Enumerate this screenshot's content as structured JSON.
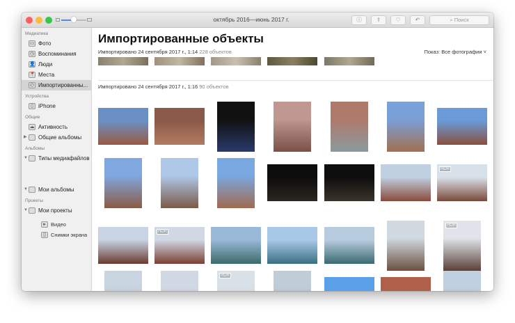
{
  "window": {
    "title": "октябрь 2016—июнь 2017 г."
  },
  "toolbar": {
    "info": "ⓘ",
    "share": "⇪",
    "favorite": "♡",
    "rotate": "↶",
    "search_placeholder": "Поиск"
  },
  "sidebar": {
    "sections": [
      {
        "label": "Медиатека",
        "items": [
          {
            "label": "Фото",
            "icon": "photos-icon"
          },
          {
            "label": "Воспоминания",
            "icon": "memories-icon"
          },
          {
            "label": "Люди",
            "icon": "people-icon"
          },
          {
            "label": "Места",
            "icon": "places-icon"
          },
          {
            "label": "Импортированны...",
            "icon": "clock-icon",
            "selected": true
          }
        ]
      },
      {
        "label": "Устройства",
        "items": [
          {
            "label": "iPhone",
            "icon": "iphone-icon"
          }
        ]
      },
      {
        "label": "Общие",
        "items": [
          {
            "label": "Активность",
            "icon": "cloud-icon"
          },
          {
            "label": "Общие альбомы",
            "icon": "album-icon",
            "disclosure": "▶"
          }
        ]
      },
      {
        "label": "Альбомы",
        "items": [
          {
            "label": "Типы медиафайлов",
            "icon": "album-icon",
            "disclosure": "▼"
          },
          {
            "label": "Видео",
            "icon": "video-icon",
            "indent": true
          },
          {
            "label": "Снимки экрана",
            "icon": "screenshot-icon",
            "indent": true
          },
          {
            "label": "Мои альбомы",
            "icon": "album-icon",
            "disclosure": "▼"
          }
        ]
      },
      {
        "label": "Проекты",
        "items": [
          {
            "label": "Мои проекты",
            "icon": "album-icon",
            "disclosure": "▼"
          }
        ]
      }
    ]
  },
  "main": {
    "title": "Импортированные объекты",
    "import1": {
      "label": "Импортировано 24 сентября 2017 г., 1:14",
      "count": "228 объектов"
    },
    "show": "Показ: Все фотографии ˅",
    "import2": {
      "label": "Импортировано 24 сентября 2017 г., 1:16",
      "count": "90 объектов"
    },
    "hdr_label": "HDR",
    "photos": [
      {
        "o": "landscape",
        "c1": "#6a8fc4",
        "c2": "#9a5a44"
      },
      {
        "o": "landscape",
        "c1": "#8a5a48",
        "c2": "#b27b62"
      },
      {
        "o": "portrait",
        "c1": "#111",
        "c2": "#2a3a6a"
      },
      {
        "o": "portrait",
        "c1": "#c09890",
        "c2": "#7a5048"
      },
      {
        "o": "portrait",
        "c1": "#b07a6a",
        "c2": "#8a9aa0"
      },
      {
        "o": "portrait",
        "c1": "#7aa0d8",
        "c2": "#a07050"
      },
      {
        "o": "landscape",
        "c1": "#6a9ad8",
        "c2": "#8a5040"
      },
      {
        "o": "portrait",
        "c1": "#80a8e0",
        "c2": "#8a5a44"
      },
      {
        "o": "portrait",
        "c1": "#b0c8e8",
        "c2": "#7a5a48"
      },
      {
        "o": "portrait",
        "c1": "#7aa8e0",
        "c2": "#a06a50"
      },
      {
        "o": "landscape",
        "c1": "#0c0c0c",
        "c2": "#2a2620"
      },
      {
        "o": "landscape",
        "c1": "#0e0e0e",
        "c2": "#3a342a"
      },
      {
        "o": "landscape",
        "c1": "#c0d0e0",
        "c2": "#8a4a3a"
      },
      {
        "o": "landscape",
        "c1": "#d8e0ea",
        "c2": "#7a4a3a",
        "hdr": true
      },
      {
        "o": "landscape",
        "c1": "#c8d4e4",
        "c2": "#6a3a30"
      },
      {
        "o": "landscape",
        "c1": "#d0d8e4",
        "c2": "#7a4034",
        "hdr": true
      },
      {
        "o": "landscape",
        "c1": "#9ab8d8",
        "c2": "#3a6a6a"
      },
      {
        "o": "landscape",
        "c1": "#a8c8e8",
        "c2": "#3a7080"
      },
      {
        "o": "landscape",
        "c1": "#b8cce0",
        "c2": "#3a6a70"
      },
      {
        "o": "portrait",
        "c1": "#d0d8e0",
        "c2": "#6a5040"
      },
      {
        "o": "portrait",
        "c1": "#e0e4ea",
        "c2": "#5a4038",
        "hdr": true
      },
      {
        "o": "portrait",
        "c1": "#c8d4e0",
        "c2": "#6a5a50"
      },
      {
        "o": "portrait",
        "c1": "#d0d8e4",
        "c2": "#7a6a60"
      },
      {
        "o": "portrait",
        "c1": "#d8e0e8",
        "c2": "#8a7a70",
        "hdr": true
      },
      {
        "o": "portrait",
        "c1": "#c0ccd8",
        "c2": "#6a5a50"
      },
      {
        "o": "landscape",
        "c1": "#5aa0e8",
        "c2": "#8ac0f0"
      },
      {
        "o": "landscape",
        "c1": "#b0604a",
        "c2": "#e0c070"
      },
      {
        "o": "portrait",
        "c1": "#c0d0e0",
        "c2": "#8a5040"
      }
    ]
  }
}
